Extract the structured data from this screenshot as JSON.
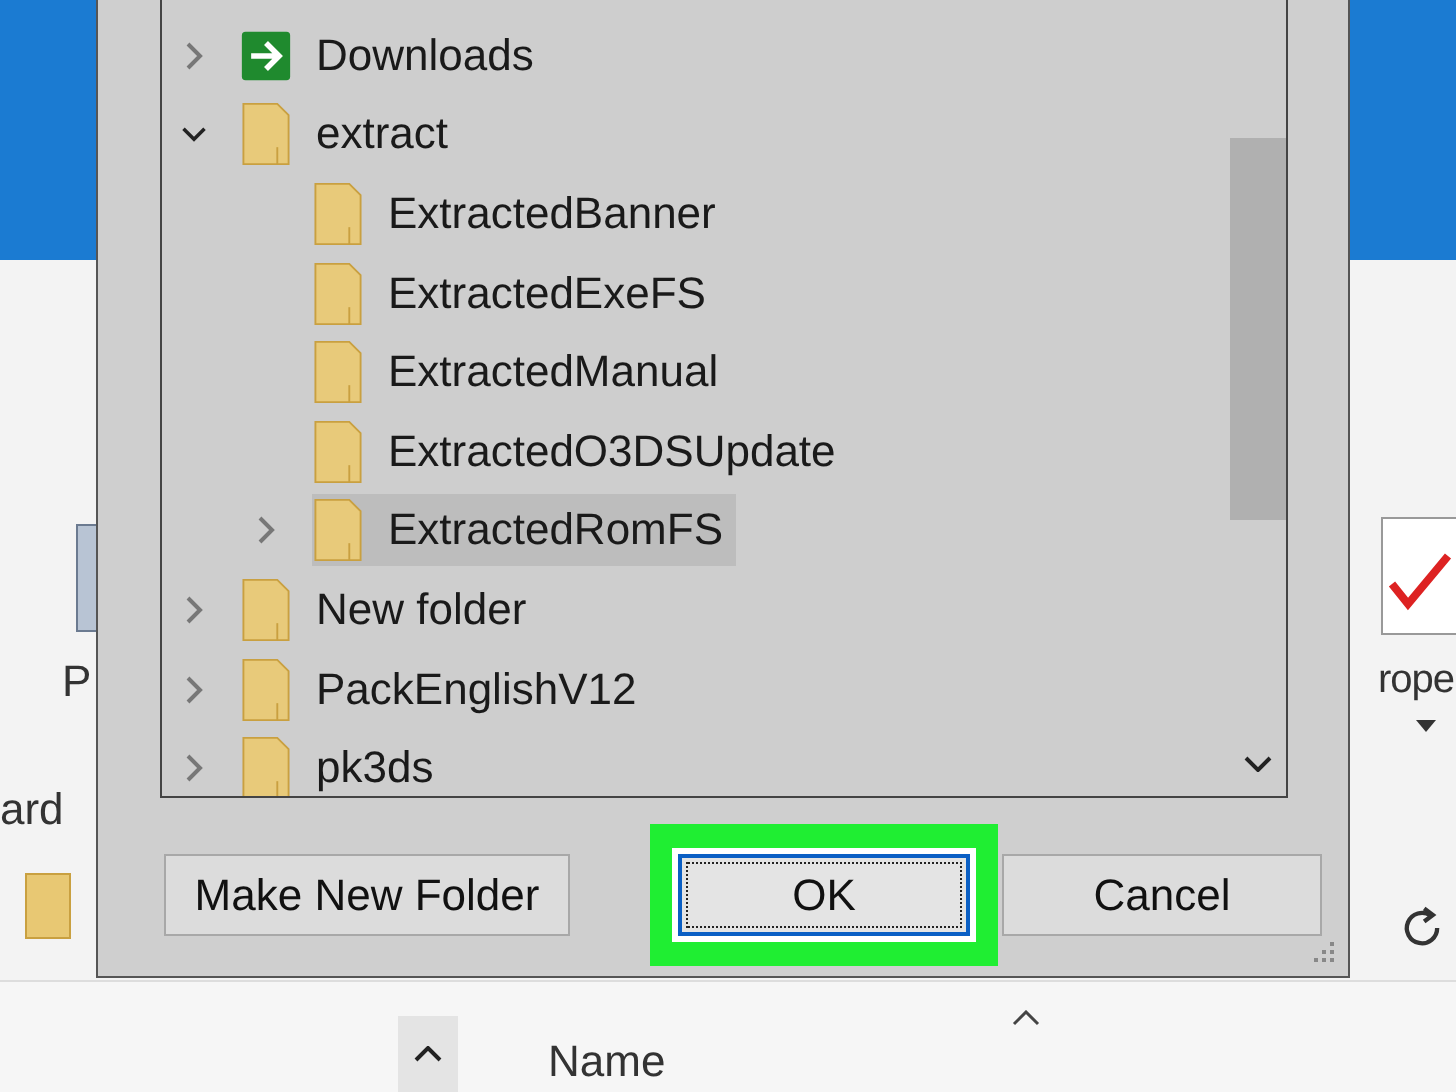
{
  "background_window": {
    "left_labels": [
      "P",
      "ard"
    ],
    "right_labels": [
      "rope"
    ],
    "column_header": "Name"
  },
  "tree": {
    "items": [
      {
        "label": "Downloads",
        "kind": "download",
        "has_children": true,
        "expanded": false,
        "selected": false
      },
      {
        "label": "extract",
        "kind": "folder",
        "has_children": true,
        "expanded": true,
        "selected": false,
        "children": [
          {
            "label": "ExtractedBanner",
            "kind": "folder",
            "has_children": false,
            "selected": false
          },
          {
            "label": "ExtractedExeFS",
            "kind": "folder",
            "has_children": false,
            "selected": false
          },
          {
            "label": "ExtractedManual",
            "kind": "folder",
            "has_children": false,
            "selected": false
          },
          {
            "label": "ExtractedO3DSUpdate",
            "kind": "folder",
            "has_children": false,
            "selected": false
          },
          {
            "label": "ExtractedRomFS",
            "kind": "folder",
            "has_children": true,
            "expanded": false,
            "selected": true
          }
        ]
      },
      {
        "label": "New folder",
        "kind": "folder",
        "has_children": true,
        "expanded": false,
        "selected": false
      },
      {
        "label": "PackEnglishV12",
        "kind": "folder",
        "has_children": true,
        "expanded": false,
        "selected": false
      },
      {
        "label": "pk3ds",
        "kind": "folder",
        "has_children": true,
        "expanded": false,
        "selected": false
      }
    ]
  },
  "buttons": [
    {
      "label": "Make New Folder",
      "default": false,
      "highlighted": false
    },
    {
      "label": "OK",
      "default": true,
      "highlighted": true
    },
    {
      "label": "Cancel",
      "default": false,
      "highlighted": false
    }
  ]
}
